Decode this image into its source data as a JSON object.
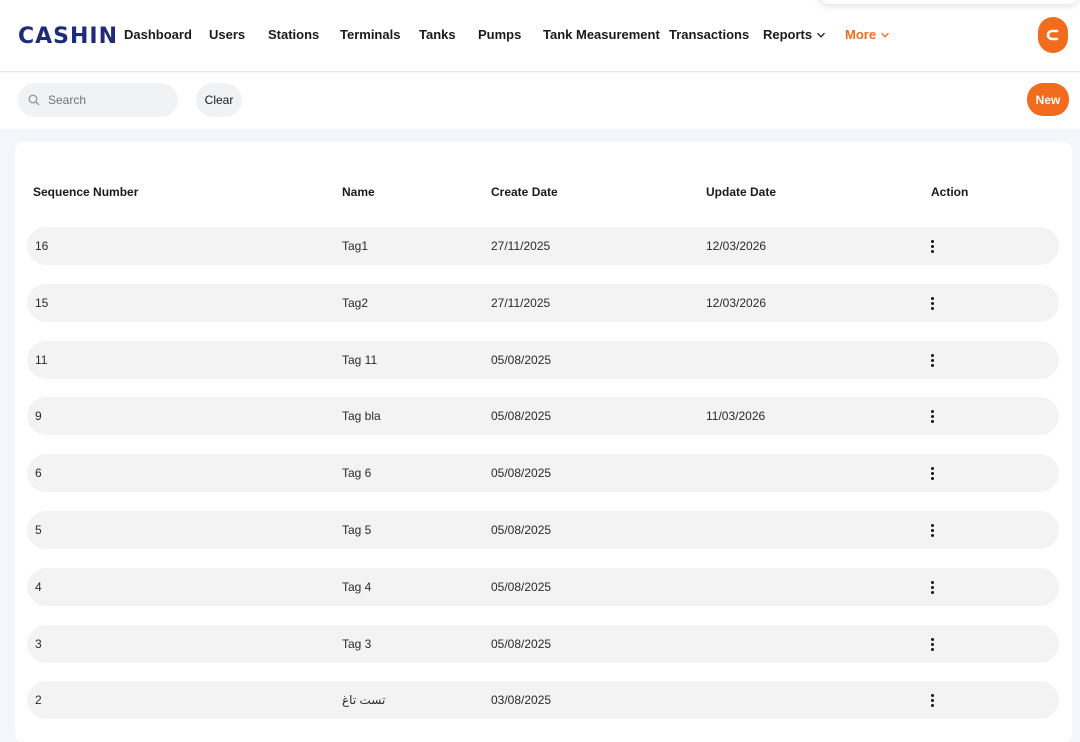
{
  "app": {
    "logo_text": "CASHIN"
  },
  "nav": {
    "items": [
      {
        "label": "Dashboard"
      },
      {
        "label": "Users"
      },
      {
        "label": "Stations"
      },
      {
        "label": "Terminals"
      },
      {
        "label": "Tanks"
      },
      {
        "label": "Pumps"
      },
      {
        "label": "Tank Measurement"
      },
      {
        "label": "Transactions"
      },
      {
        "label": "Reports"
      },
      {
        "label": "More"
      }
    ]
  },
  "toolbar": {
    "search_placeholder": "Search",
    "clear_label": "Clear",
    "new_label": "New"
  },
  "table": {
    "columns": [
      "Sequence Number",
      "Name",
      "Create Date",
      "Update Date",
      "Action"
    ],
    "rows": [
      {
        "seq": "16",
        "name": "Tag1",
        "created": "27/11/2025",
        "updated": "12/03/2026"
      },
      {
        "seq": "15",
        "name": "Tag2",
        "created": "27/11/2025",
        "updated": "12/03/2026"
      },
      {
        "seq": "11",
        "name": "Tag 11",
        "created": "05/08/2025",
        "updated": ""
      },
      {
        "seq": "9",
        "name": "Tag bla",
        "created": "05/08/2025",
        "updated": "11/03/2026"
      },
      {
        "seq": "6",
        "name": "Tag 6",
        "created": "05/08/2025",
        "updated": ""
      },
      {
        "seq": "5",
        "name": "Tag 5",
        "created": "05/08/2025",
        "updated": ""
      },
      {
        "seq": "4",
        "name": "Tag 4",
        "created": "05/08/2025",
        "updated": ""
      },
      {
        "seq": "3",
        "name": "Tag 3",
        "created": "05/08/2025",
        "updated": ""
      },
      {
        "seq": "2",
        "name": "تست تاغ",
        "created": "03/08/2025",
        "updated": ""
      }
    ]
  },
  "colors": {
    "accent": "#f26c1d",
    "brand": "#1f2a7a"
  }
}
